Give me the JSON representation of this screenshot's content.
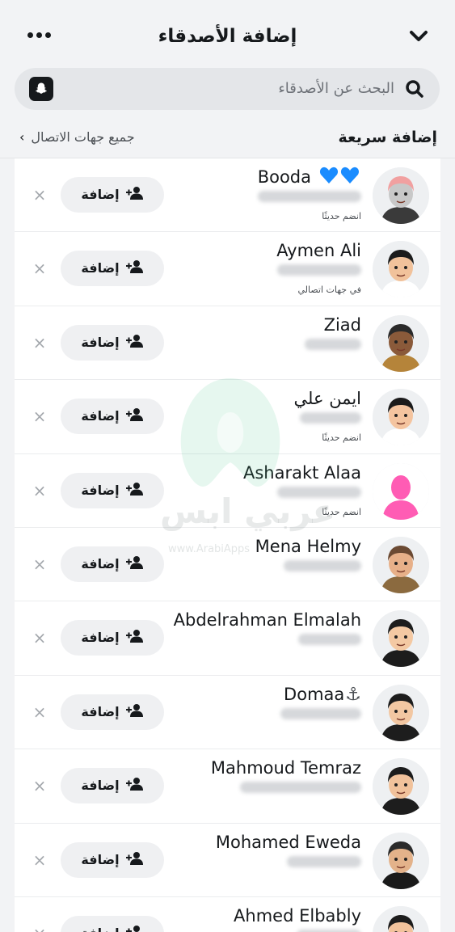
{
  "header": {
    "title": "إضافة الأصدقاء",
    "search_placeholder": "البحث عن الأصدقاء",
    "quick_add_label": "إضافة سريعة",
    "all_contacts_label": "جميع جهات الاتصال"
  },
  "rows": [
    {
      "name": "Booda",
      "extra": "💙💙",
      "status": "انضم حديثًا"
    },
    {
      "name": "Aymen Ali",
      "status": "في جهات اتصالي"
    },
    {
      "name": "Ziad",
      "status": ""
    },
    {
      "name": "ايمن علي",
      "status": "انضم حديثًا"
    },
    {
      "name": "Asharakt Alaa",
      "status": "انضم حديثًا"
    },
    {
      "name": "Mena Helmy",
      "status": ""
    },
    {
      "name": "Abdelrahman Elmalah",
      "status": ""
    },
    {
      "name": "Domaa",
      "extra": "⚓",
      "status": ""
    },
    {
      "name": "Mahmoud Temraz",
      "status": ""
    },
    {
      "name": "Mohamed Eweda",
      "status": ""
    },
    {
      "name": "Ahmed Elbably",
      "status": ""
    }
  ],
  "add_label": "إضافة",
  "dismiss_glyph": "×",
  "watermark": {
    "text": "عربي ابس",
    "url": "www.ArabiApps"
  },
  "colors": {
    "background": "#f2f3f5",
    "row_bg": "#ffffff",
    "button_bg": "#eff0f2",
    "text": "#16191c",
    "heart": "#1a8cff",
    "watermark": "#3cbf82"
  }
}
